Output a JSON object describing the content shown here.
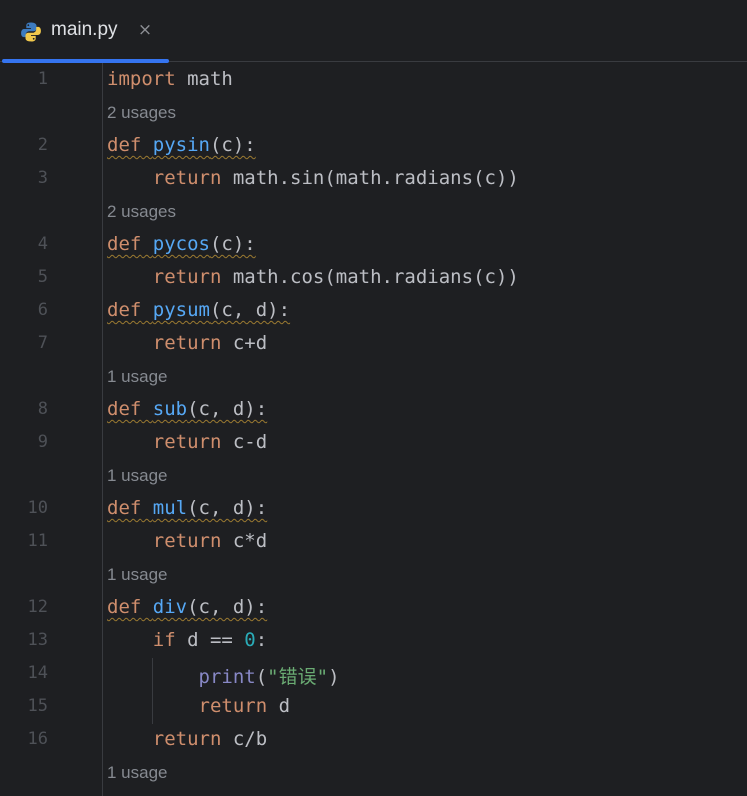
{
  "tab": {
    "icon": "python-icon",
    "label": "main.py",
    "close": "×",
    "accent": "#3574f0"
  },
  "colors": {
    "background": "#1e1f22",
    "keyword": "#cf8e6d",
    "function": "#56a8f5",
    "builtin": "#8888c6",
    "number": "#2aacb8",
    "string": "#6aab73",
    "hint": "#868a91",
    "line_number": "#4e5157"
  },
  "lines": [
    {
      "type": "code",
      "ln": "1",
      "indent": "",
      "tokens": [
        {
          "t": "import",
          "c": "kw"
        },
        {
          "t": " math"
        }
      ]
    },
    {
      "type": "hint",
      "text": "2 usages"
    },
    {
      "type": "code",
      "ln": "2",
      "indent": "",
      "wavy": true,
      "tokens": [
        {
          "t": "def",
          "c": "kw"
        },
        {
          "t": " "
        },
        {
          "t": "pysin",
          "c": "fn"
        },
        {
          "t": "(c):"
        }
      ]
    },
    {
      "type": "code",
      "ln": "3",
      "indent": "    ",
      "tokens": [
        {
          "t": "return",
          "c": "kw"
        },
        {
          "t": " math.sin(math.radians(c))"
        }
      ]
    },
    {
      "type": "hint",
      "text": "2 usages"
    },
    {
      "type": "code",
      "ln": "4",
      "indent": "",
      "wavy": true,
      "tokens": [
        {
          "t": "def",
          "c": "kw"
        },
        {
          "t": " "
        },
        {
          "t": "pycos",
          "c": "fn"
        },
        {
          "t": "(c):"
        }
      ]
    },
    {
      "type": "code",
      "ln": "5",
      "indent": "    ",
      "tokens": [
        {
          "t": "return",
          "c": "kw"
        },
        {
          "t": " math.cos(math.radians(c))"
        }
      ]
    },
    {
      "type": "code",
      "ln": "6",
      "indent": "",
      "wavy": true,
      "tokens": [
        {
          "t": "def",
          "c": "kw"
        },
        {
          "t": " "
        },
        {
          "t": "pysum",
          "c": "fn"
        },
        {
          "t": "(c, d):"
        }
      ]
    },
    {
      "type": "code",
      "ln": "7",
      "indent": "    ",
      "tokens": [
        {
          "t": "return",
          "c": "kw"
        },
        {
          "t": " c+d"
        }
      ]
    },
    {
      "type": "hint",
      "text": "1 usage"
    },
    {
      "type": "code",
      "ln": "8",
      "indent": "",
      "wavy": true,
      "tokens": [
        {
          "t": "def",
          "c": "kw"
        },
        {
          "t": " "
        },
        {
          "t": "sub",
          "c": "fn"
        },
        {
          "t": "(c, d):"
        }
      ]
    },
    {
      "type": "code",
      "ln": "9",
      "indent": "    ",
      "tokens": [
        {
          "t": "return",
          "c": "kw"
        },
        {
          "t": " c-d"
        }
      ]
    },
    {
      "type": "hint",
      "text": "1 usage"
    },
    {
      "type": "code",
      "ln": "10",
      "indent": "",
      "wavy": true,
      "tokens": [
        {
          "t": "def",
          "c": "kw"
        },
        {
          "t": " "
        },
        {
          "t": "mul",
          "c": "fn"
        },
        {
          "t": "(c, d):"
        }
      ]
    },
    {
      "type": "code",
      "ln": "11",
      "indent": "    ",
      "tokens": [
        {
          "t": "return",
          "c": "kw"
        },
        {
          "t": " c*d"
        }
      ]
    },
    {
      "type": "hint",
      "text": "1 usage"
    },
    {
      "type": "code",
      "ln": "12",
      "indent": "",
      "wavy": true,
      "tokens": [
        {
          "t": "def",
          "c": "kw"
        },
        {
          "t": " "
        },
        {
          "t": "div",
          "c": "fn"
        },
        {
          "t": "(c, d):"
        }
      ]
    },
    {
      "type": "code",
      "ln": "13",
      "indent": "    ",
      "tokens": [
        {
          "t": "if",
          "c": "kw"
        },
        {
          "t": " d == "
        },
        {
          "t": "0",
          "c": "num"
        },
        {
          "t": ":"
        }
      ]
    },
    {
      "type": "code",
      "ln": "14",
      "indent": "        ",
      "tokens": [
        {
          "t": "print",
          "c": "builtin"
        },
        {
          "t": "("
        },
        {
          "t": "\"错误\"",
          "c": "str"
        },
        {
          "t": ")"
        }
      ]
    },
    {
      "type": "code",
      "ln": "15",
      "indent": "        ",
      "tokens": [
        {
          "t": "return",
          "c": "kw"
        },
        {
          "t": " d"
        }
      ]
    },
    {
      "type": "code",
      "ln": "16",
      "indent": "    ",
      "tokens": [
        {
          "t": "return",
          "c": "kw"
        },
        {
          "t": " c/b"
        }
      ]
    },
    {
      "type": "hint",
      "text": "1 usage"
    }
  ]
}
